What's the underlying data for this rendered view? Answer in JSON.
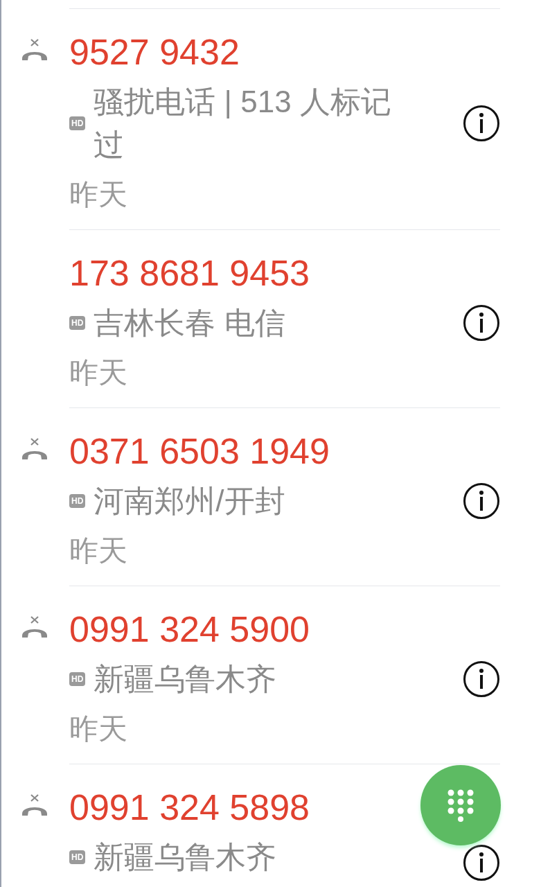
{
  "calls": [
    {
      "number": "9527 9432",
      "missed": true,
      "badge": "HD",
      "detail": "骚扰电话 | 513 人标记过",
      "date": "昨天"
    },
    {
      "number": "173 8681 9453",
      "missed": false,
      "badge": "HD",
      "detail": "吉林长春 电信",
      "date": "昨天"
    },
    {
      "number": "0371 6503 1949",
      "missed": true,
      "badge": "HD",
      "detail": "河南郑州/开封",
      "date": "昨天"
    },
    {
      "number": "0991 324 5900",
      "missed": true,
      "badge": "HD",
      "detail": "新疆乌鲁木齐",
      "date": "昨天"
    },
    {
      "number": "0991 324 5898",
      "missed": true,
      "badge": "HD",
      "detail": "新疆乌鲁木齐"
    }
  ]
}
